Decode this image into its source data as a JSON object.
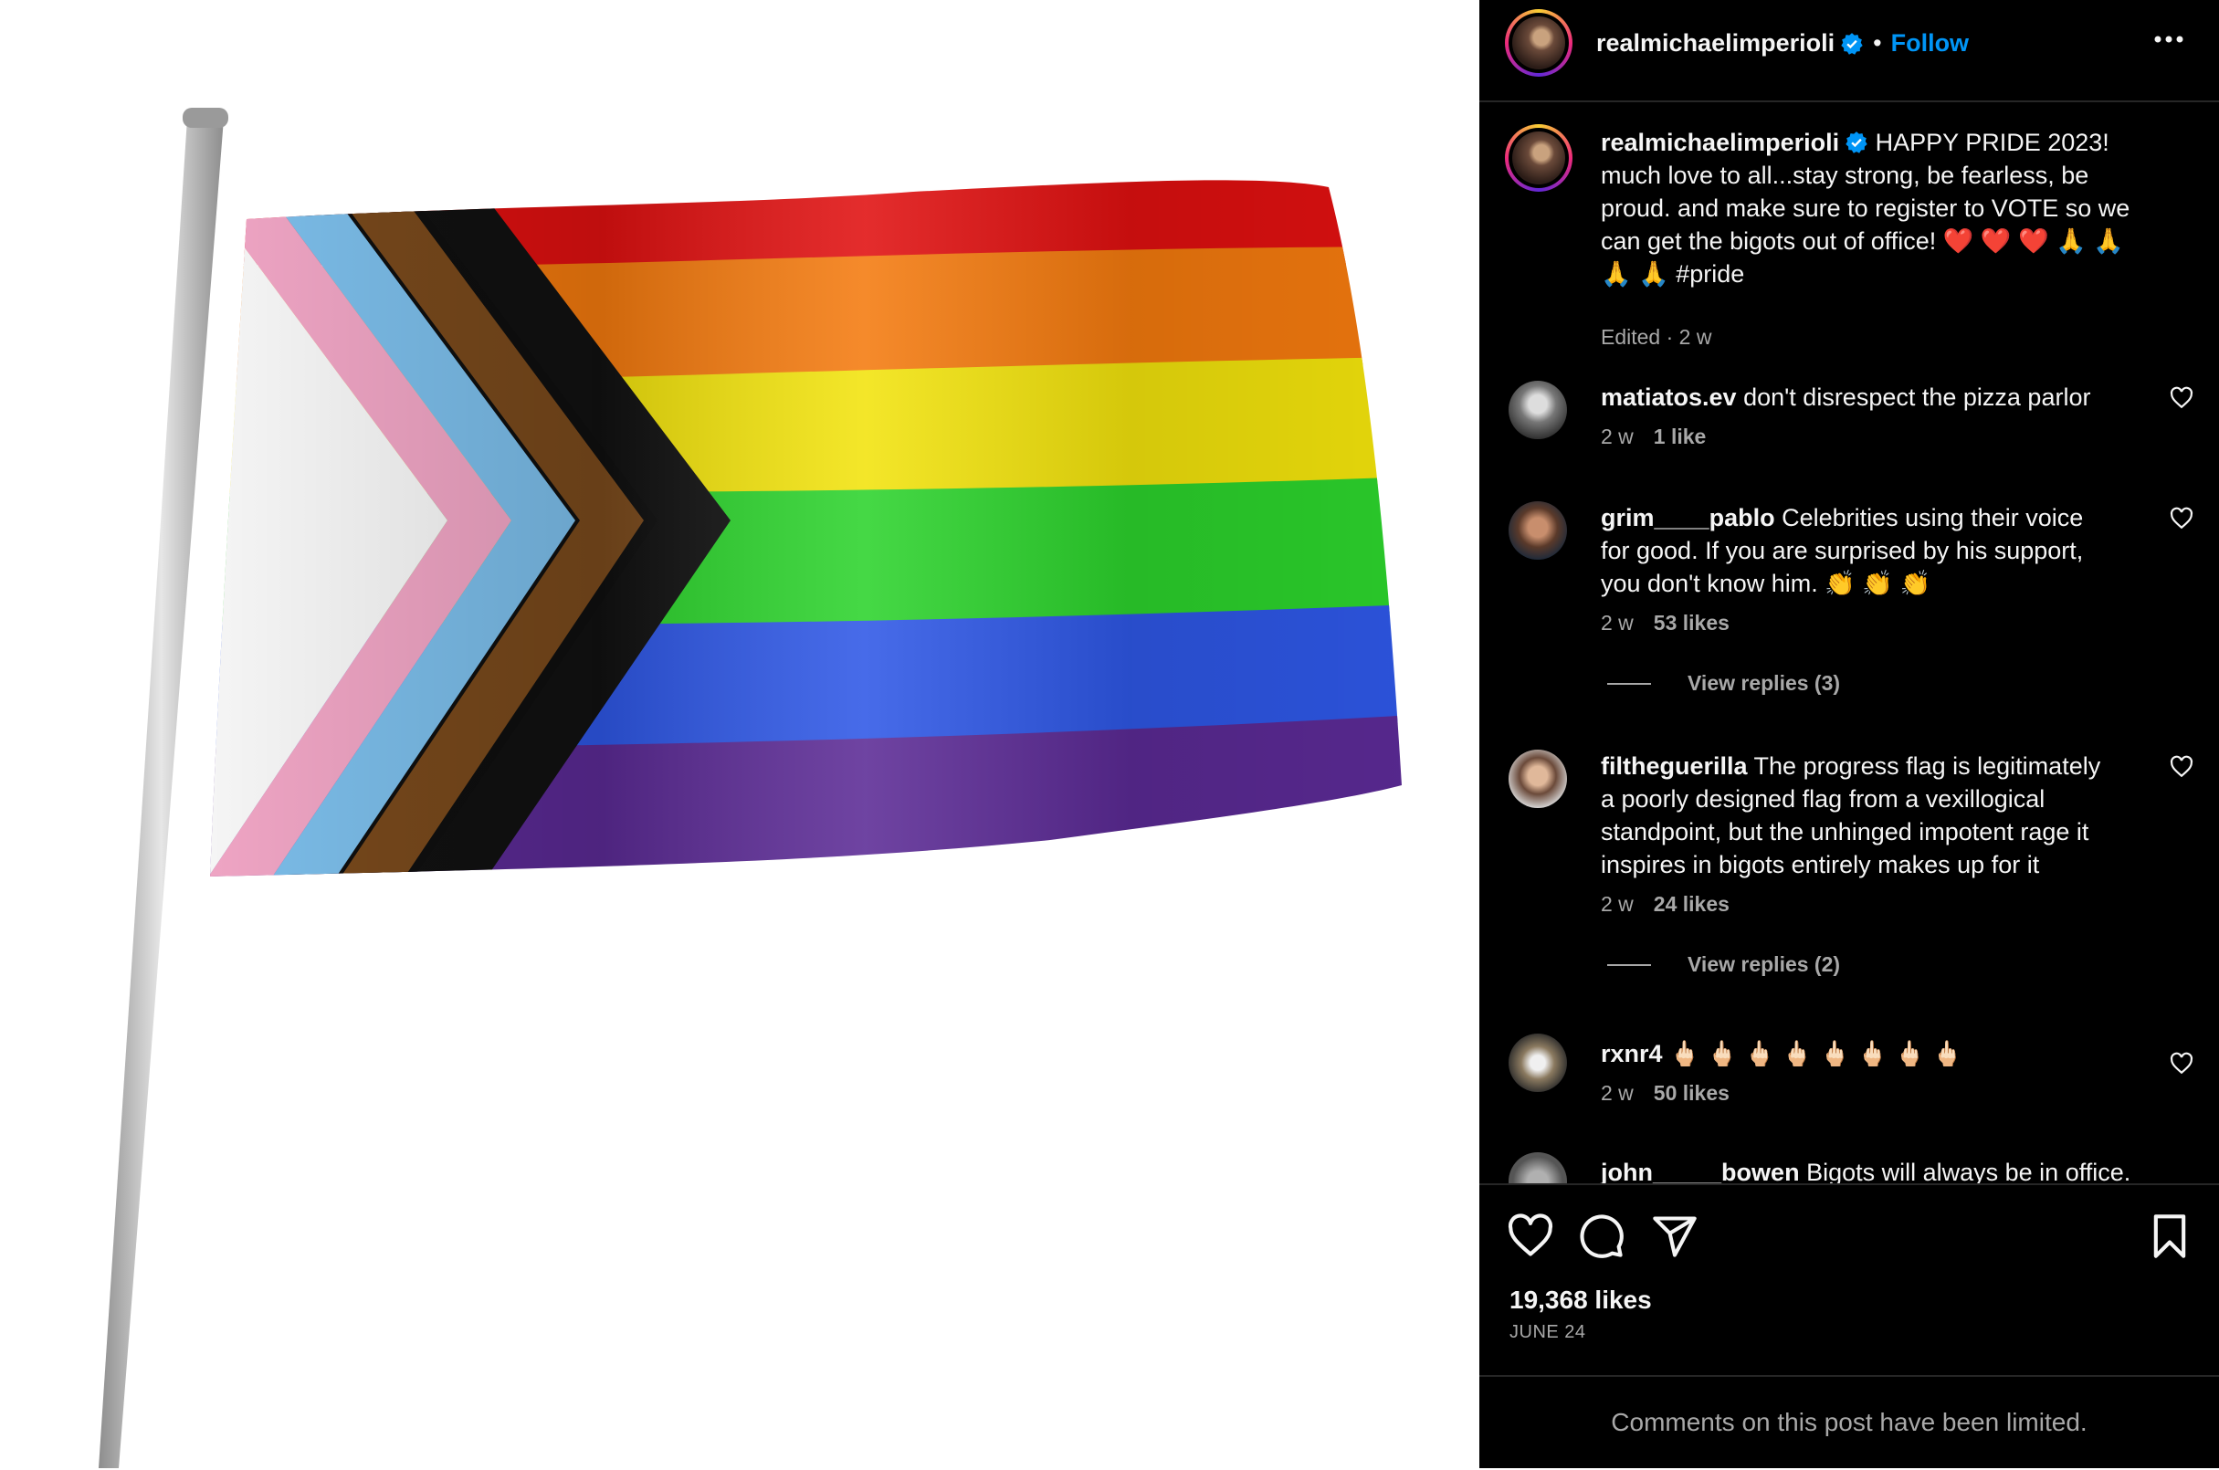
{
  "post": {
    "username": "realmichaelimperioli",
    "follow_label": "Follow",
    "separator": "•",
    "caption_line1": "HAPPY PRIDE 2023!",
    "caption_line2": "much love to all...stay strong, be fearless, be",
    "caption_line3": "proud. and make sure to register to VOTE so we",
    "caption_line4": "can get the bigots out of office! ❤️ ❤️ ❤️ 🙏 🙏",
    "caption_line5": "🙏 🙏 #pride",
    "caption_meta": "Edited · 2 w",
    "likes": "19,368 likes",
    "date": "JUNE 24",
    "limited_notice": "Comments on this post have been limited."
  },
  "comments": [
    {
      "user": "matiatos.ev",
      "lines": [
        "don't disrespect the pizza parlor"
      ],
      "age": "2 w",
      "likes": "1 like"
    },
    {
      "user": "grim____pablo",
      "lines": [
        "Celebrities using their voice",
        "for good. If you are surprised by his support,",
        "you don't know him. 👏 👏 👏"
      ],
      "age": "2 w",
      "likes": "53 likes",
      "replies": "View replies (3)"
    },
    {
      "user": "filtheguerilla",
      "lines": [
        "The progress flag is legitimately",
        "a poorly designed flag from a vexillogical",
        "standpoint, but the unhinged impotent rage it",
        "inspires in bigots entirely makes up for it"
      ],
      "age": "2 w",
      "likes": "24 likes",
      "replies": "View replies (2)"
    },
    {
      "user": "rxnr4",
      "lines": [
        "🖕🏻 🖕🏻 🖕🏻 🖕🏻 🖕🏻 🖕🏻 🖕🏻 🖕🏻"
      ],
      "age": "2 w",
      "likes": "50 likes"
    },
    {
      "user": "john_____bowen",
      "lines": [
        "Bigots will always be in office."
      ]
    }
  ],
  "icons": {
    "more": "more-options-icon",
    "verified": "verified-badge-icon",
    "like": "heart-icon",
    "comment": "comment-icon",
    "share": "share-icon",
    "save": "bookmark-icon"
  },
  "colors": {
    "follow": "#0095f6",
    "panel_bg": "#000000",
    "muted": "#a8a8a8"
  }
}
